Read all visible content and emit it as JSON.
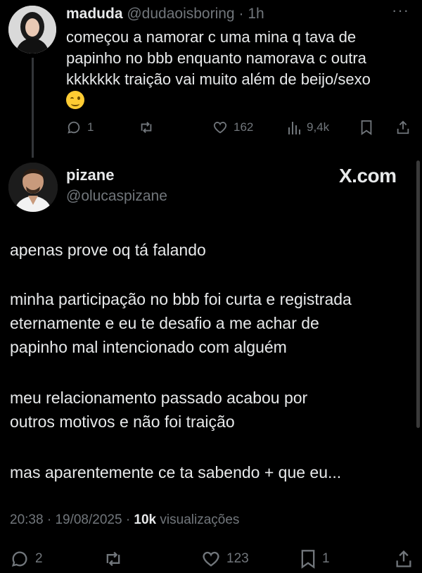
{
  "reply": {
    "name": "maduda",
    "handle": "@dudaoisboring",
    "dot": "·",
    "time": "1h",
    "more": "···",
    "lines": [
      "começou a namorar c uma mina q tava de",
      "papinho no bbb enquanto namorava c outra",
      "kkkkkkk traição vai muito além de beijo/sexo"
    ],
    "emoji": "winking-face",
    "actions": {
      "replies": "1",
      "likes": "162",
      "views": "9,4k"
    }
  },
  "main": {
    "name": "pizane",
    "handle": "@olucaspizane",
    "brand": "X.com",
    "paragraphs": [
      [
        "apenas prove oq tá falando"
      ],
      [
        "minha participação no bbb foi curta e registrada",
        "eternamente e eu te desafio a me achar de",
        "papinho mal intencionado com alguém"
      ],
      [
        "meu relacionamento passado acabou por",
        "outros motivos e não foi traição"
      ],
      [
        "mas aparentemente ce ta sabendo + que eu..."
      ]
    ],
    "meta": {
      "time": "20:38",
      "sep": "·",
      "date": "19/08/2025",
      "views_count": "10k",
      "views_label": "visualizações"
    },
    "actions": {
      "replies": "2",
      "likes": "123",
      "bookmarks": "1"
    }
  },
  "colors": {
    "background": "#000000",
    "text": "#e7e9ea",
    "muted": "#71767b"
  }
}
